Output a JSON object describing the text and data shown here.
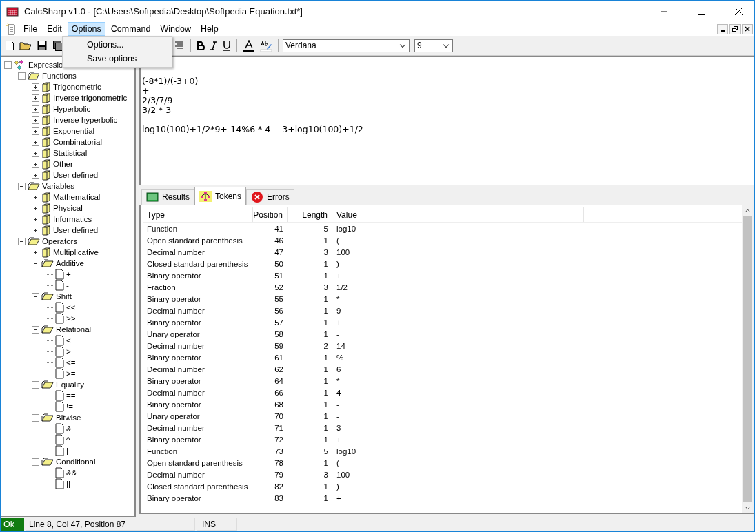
{
  "window": {
    "title": "CalcSharp v1.0 - [C:\\Users\\Softpedia\\Desktop\\Softpedia Equation.txt*]"
  },
  "menu": [
    {
      "label": "File",
      "selected": false
    },
    {
      "label": "Edit",
      "selected": false
    },
    {
      "label": "Options",
      "selected": true
    },
    {
      "label": "Command",
      "selected": false
    },
    {
      "label": "Window",
      "selected": false
    },
    {
      "label": "Help",
      "selected": false
    }
  ],
  "dropdown": [
    "Options...",
    "Save options"
  ],
  "toolbar": {
    "font": "Verdana",
    "size": "9"
  },
  "tree": [
    {
      "label": "Expressio",
      "kind": "root",
      "expanded": true,
      "children": [
        {
          "label": "Functions",
          "kind": "folder",
          "expanded": true,
          "children": [
            {
              "label": "Trigonometric",
              "kind": "folder",
              "expanded": false
            },
            {
              "label": "Inverse trigonometric",
              "kind": "folder",
              "expanded": false
            },
            {
              "label": "Hyperbolic",
              "kind": "folder",
              "expanded": false
            },
            {
              "label": "Inverse hyperbolic",
              "kind": "folder",
              "expanded": false
            },
            {
              "label": "Exponential",
              "kind": "folder",
              "expanded": false
            },
            {
              "label": "Combinatorial",
              "kind": "folder",
              "expanded": false
            },
            {
              "label": "Statistical",
              "kind": "folder",
              "expanded": false
            },
            {
              "label": "Other",
              "kind": "folder",
              "expanded": false
            },
            {
              "label": "User defined",
              "kind": "folder",
              "expanded": false
            }
          ]
        },
        {
          "label": "Variables",
          "kind": "folder",
          "expanded": true,
          "children": [
            {
              "label": "Mathematical",
              "kind": "folder",
              "expanded": false
            },
            {
              "label": "Physical",
              "kind": "folder",
              "expanded": false
            },
            {
              "label": "Informatics",
              "kind": "folder",
              "expanded": false
            },
            {
              "label": "User defined",
              "kind": "folder",
              "expanded": false
            }
          ]
        },
        {
          "label": "Operators",
          "kind": "folder",
          "expanded": true,
          "children": [
            {
              "label": "Multiplicative",
              "kind": "folder",
              "expanded": false
            },
            {
              "label": "Additive",
              "kind": "folder",
              "expanded": true,
              "children": [
                {
                  "label": "+",
                  "kind": "leaf"
                },
                {
                  "label": "-",
                  "kind": "leaf"
                }
              ]
            },
            {
              "label": "Shift",
              "kind": "folder",
              "expanded": true,
              "children": [
                {
                  "label": "<<",
                  "kind": "leaf"
                },
                {
                  "label": ">>",
                  "kind": "leaf"
                }
              ]
            },
            {
              "label": "Relational",
              "kind": "folder",
              "expanded": true,
              "children": [
                {
                  "label": "<",
                  "kind": "leaf"
                },
                {
                  "label": ">",
                  "kind": "leaf"
                },
                {
                  "label": "<=",
                  "kind": "leaf"
                },
                {
                  "label": ">=",
                  "kind": "leaf"
                }
              ]
            },
            {
              "label": "Equality",
              "kind": "folder",
              "expanded": true,
              "children": [
                {
                  "label": "==",
                  "kind": "leaf"
                },
                {
                  "label": "!=",
                  "kind": "leaf"
                }
              ]
            },
            {
              "label": "Bitwise",
              "kind": "folder",
              "expanded": true,
              "children": [
                {
                  "label": "&",
                  "kind": "leaf"
                },
                {
                  "label": "^",
                  "kind": "leaf"
                },
                {
                  "label": "|",
                  "kind": "leaf"
                }
              ]
            },
            {
              "label": "Conditional",
              "kind": "folder",
              "expanded": true,
              "children": [
                {
                  "label": "&&",
                  "kind": "leaf"
                },
                {
                  "label": "||",
                  "kind": "leaf"
                }
              ]
            }
          ]
        }
      ]
    }
  ],
  "editor": {
    "text": "(-8*1)/(-3+0)\n+\n2/3/7/9-\n3/2 * 3\n\nlog10(100)+1/2*9+-14%6 * 4 - -3+log10(100)+1/2"
  },
  "tabs": [
    {
      "label": "Results",
      "kind": "results",
      "selected": false
    },
    {
      "label": "Tokens",
      "kind": "tokens",
      "selected": true
    },
    {
      "label": "Errors",
      "kind": "errors",
      "selected": false
    }
  ],
  "table": {
    "columns": [
      "Type",
      "Position",
      "Length",
      "Value"
    ],
    "rows": [
      [
        "Function",
        "41",
        "5",
        "log10"
      ],
      [
        "Open standard parenthesis",
        "46",
        "1",
        "("
      ],
      [
        "Decimal number",
        "47",
        "3",
        "100"
      ],
      [
        "Closed standard parenthesis",
        "50",
        "1",
        ")"
      ],
      [
        "Binary operator",
        "51",
        "1",
        "+"
      ],
      [
        "Fraction",
        "52",
        "3",
        "1/2"
      ],
      [
        "Binary operator",
        "55",
        "1",
        "*"
      ],
      [
        "Decimal number",
        "56",
        "1",
        "9"
      ],
      [
        "Binary operator",
        "57",
        "1",
        "+"
      ],
      [
        "Unary operator",
        "58",
        "1",
        "-"
      ],
      [
        "Decimal number",
        "59",
        "2",
        "14"
      ],
      [
        "Binary operator",
        "61",
        "1",
        "%"
      ],
      [
        "Decimal number",
        "62",
        "1",
        "6"
      ],
      [
        "Binary operator",
        "64",
        "1",
        "*"
      ],
      [
        "Decimal number",
        "66",
        "1",
        "4"
      ],
      [
        "Binary operator",
        "68",
        "1",
        "-"
      ],
      [
        "Unary operator",
        "70",
        "1",
        "-"
      ],
      [
        "Decimal number",
        "71",
        "1",
        "3"
      ],
      [
        "Binary operator",
        "72",
        "1",
        "+"
      ],
      [
        "Function",
        "73",
        "5",
        "log10"
      ],
      [
        "Open standard parenthesis",
        "78",
        "1",
        "("
      ],
      [
        "Decimal number",
        "79",
        "3",
        "100"
      ],
      [
        "Closed standard parenthesis",
        "82",
        "1",
        ")"
      ],
      [
        "Binary operator",
        "83",
        "1",
        "+"
      ]
    ]
  },
  "status_bar": {
    "state": "Ok",
    "position": "Line 8, Col 47, Position 87",
    "mode": "INS"
  }
}
